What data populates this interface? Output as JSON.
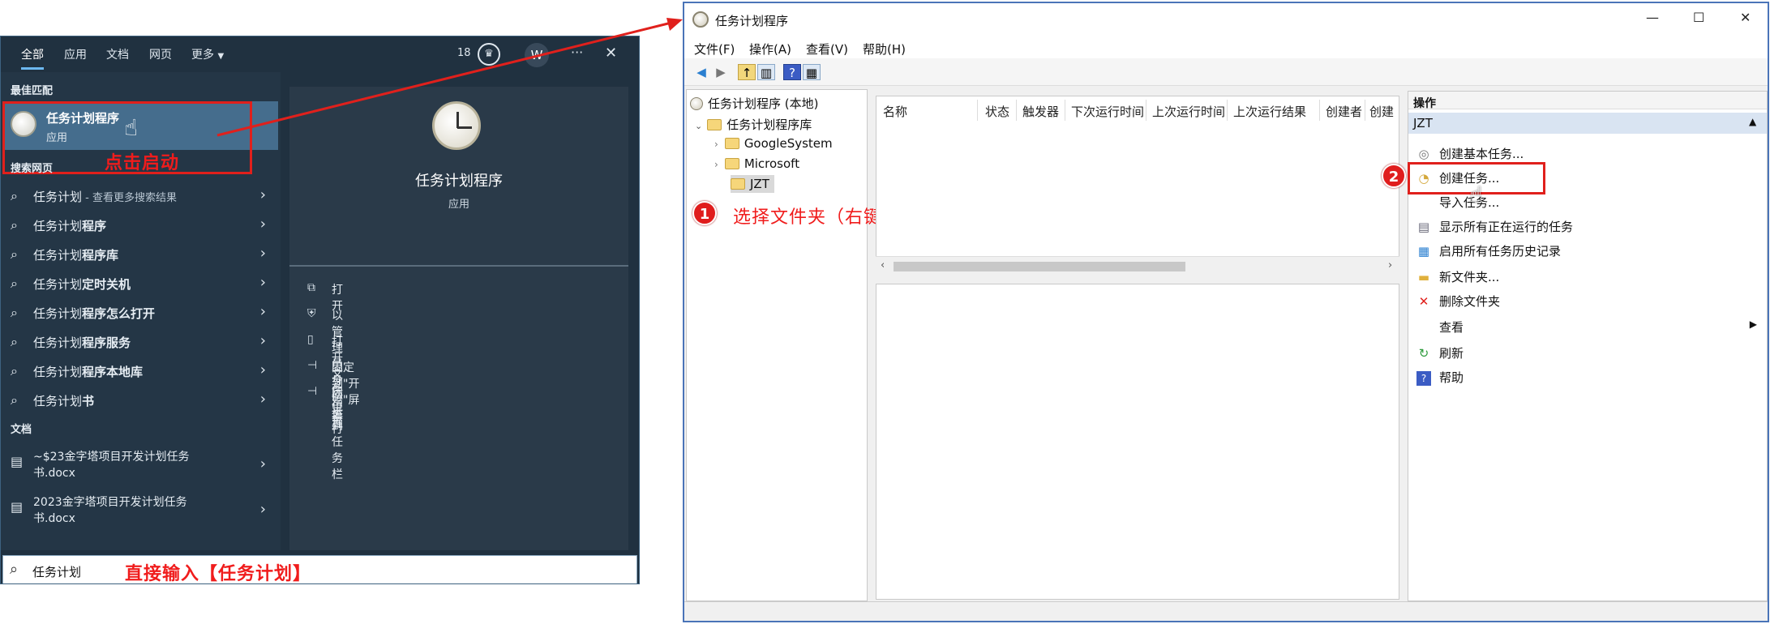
{
  "start_menu": {
    "tabs": [
      "全部",
      "应用",
      "文档",
      "网页",
      "更多"
    ],
    "badge_count": "18",
    "avatar_initial": "W",
    "more_label": "···",
    "close_label": "✕",
    "best_match_heading": "最佳匹配",
    "best_match": {
      "title": "任务计划程序",
      "subtitle": "应用"
    },
    "search_web_heading": "搜索网页",
    "web_results": [
      {
        "prefix": "任务计划",
        "suffix": " - 查看更多搜索结果"
      },
      {
        "prefix": "任务计划",
        "bold": "程序"
      },
      {
        "prefix": "任务计划",
        "bold": "程序库"
      },
      {
        "prefix": "任务计划",
        "bold": "定时关机"
      },
      {
        "prefix": "任务计划",
        "bold": "程序怎么打开"
      },
      {
        "prefix": "任务计划",
        "bold": "程序服务"
      },
      {
        "prefix": "任务计划",
        "bold": "程序本地库"
      },
      {
        "prefix": "任务计划",
        "bold": "书"
      }
    ],
    "docs_heading": "文档",
    "docs": [
      {
        "line1": "~$23金字塔项目开发计划任务",
        "line2": "书.docx"
      },
      {
        "line1": "2023金字塔项目开发计划任务",
        "line2": "书.docx"
      }
    ],
    "preview": {
      "title": "任务计划程序",
      "subtitle": "应用"
    },
    "preview_actions": [
      "打开",
      "以管理员身份运行",
      "打开文件位置",
      "固定到\"开始\"屏幕",
      "固定到任务栏"
    ],
    "search_value": "任务计划",
    "taskbar_icons": [
      "windows-start",
      "edge",
      "browser",
      "app",
      "file-explorer",
      "winrar",
      "notepad",
      "terminal",
      "qq"
    ]
  },
  "annotations": {
    "click_to_launch": "点击启动",
    "type_directly": "直接输入【任务计划】",
    "step1_num": "1",
    "step1_text": "选择文件夹（右键可新建文件夹）",
    "step2_num": "2"
  },
  "scheduler": {
    "title": "任务计划程序",
    "window_controls": [
      "—",
      "☐",
      "✕"
    ],
    "menus": [
      "文件(F)",
      "操作(A)",
      "查看(V)",
      "帮助(H)"
    ],
    "tree": {
      "root": "任务计划程序 (本地)",
      "library": "任务计划程序库",
      "folders": [
        "GoogleSystem",
        "Microsoft",
        "JZT"
      ]
    },
    "columns": [
      "名称",
      "状态",
      "触发器",
      "下次运行时间",
      "上次运行时间",
      "上次运行结果",
      "创建者",
      "创建"
    ],
    "actions_heading": "操作",
    "actions_section": "JZT",
    "actions": [
      {
        "icon": "create-basic-task-icon",
        "label": "创建基本任务..."
      },
      {
        "icon": "create-task-icon",
        "label": "创建任务..."
      },
      {
        "icon": "",
        "label": "导入任务..."
      },
      {
        "icon": "running-tasks-icon",
        "label": "显示所有正在运行的任务"
      },
      {
        "icon": "history-icon",
        "label": "启用所有任务历史记录"
      },
      {
        "icon": "new-folder-icon",
        "label": "新文件夹..."
      },
      {
        "icon": "delete-icon",
        "label": "删除文件夹"
      },
      {
        "icon": "",
        "label": "查看"
      },
      {
        "icon": "refresh-icon",
        "label": "刷新"
      },
      {
        "icon": "help-icon",
        "label": "帮助"
      }
    ]
  },
  "colors": {
    "annotation_red": "#e0201c",
    "start_bg": "#203140",
    "highlight": "#456d8d",
    "window_border": "#4a74b8"
  }
}
